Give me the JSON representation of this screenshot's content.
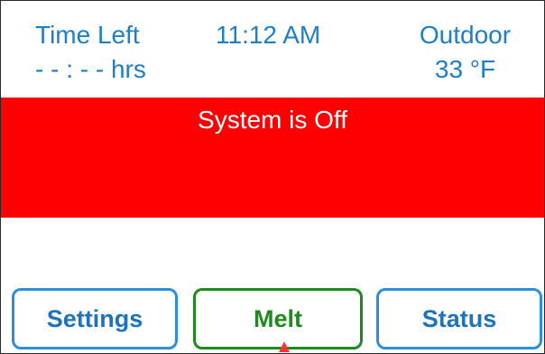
{
  "header": {
    "time_left_label": "Time Left",
    "time_left_value": "- - : - - hrs",
    "clock": "11:12 AM",
    "outdoor_label": "Outdoor",
    "outdoor_value": "33 °F"
  },
  "status": {
    "message": "System is Off",
    "color": "#ff0000"
  },
  "buttons": {
    "settings_label": "Settings",
    "melt_label": "Melt",
    "status_label": "Status"
  },
  "colors": {
    "header_text": "#1e7fc6",
    "button_border": "#2c8fd9",
    "active_button": "#1f8a1f",
    "background": "#ffffff"
  },
  "indicator": {
    "icon": "up-triangle-pointer-icon"
  }
}
